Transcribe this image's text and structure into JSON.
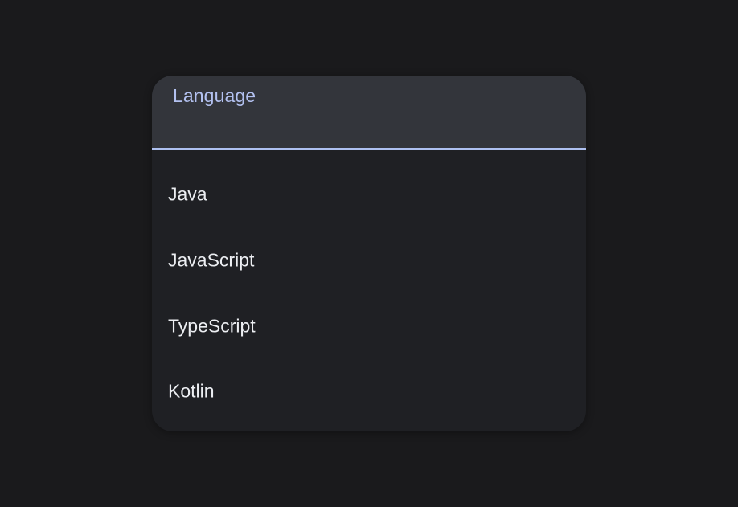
{
  "field": {
    "label": "Language"
  },
  "options": [
    {
      "label": "Java"
    },
    {
      "label": "JavaScript"
    },
    {
      "label": "TypeScript"
    },
    {
      "label": "Kotlin"
    }
  ],
  "colors": {
    "background": "#1a1a1c",
    "field_background": "#33353b",
    "menu_background": "#1f2024",
    "accent": "#aec0f0",
    "text": "#eceef2"
  }
}
